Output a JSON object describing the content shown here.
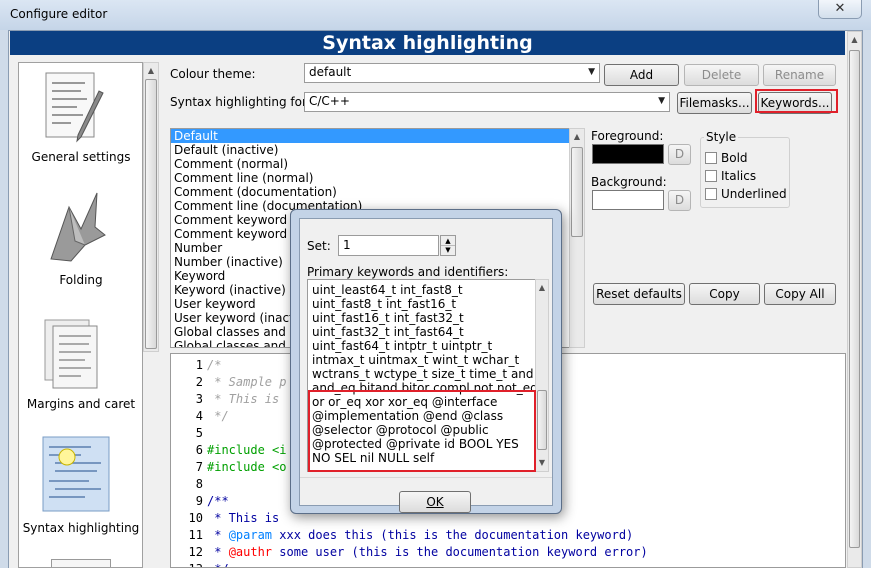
{
  "window": {
    "title": "Configure editor",
    "close_glyph": "✕"
  },
  "banner": {
    "title": "Syntax highlighting"
  },
  "sidebar": {
    "items": [
      {
        "label": "General settings",
        "icon": "general-settings-icon"
      },
      {
        "label": "Folding",
        "icon": "folding-icon"
      },
      {
        "label": "Margins and caret",
        "icon": "margins-caret-icon"
      },
      {
        "label": "Syntax highlighting",
        "icon": "syntax-highlighting-icon",
        "selected": true
      }
    ]
  },
  "theme": {
    "label": "Colour theme:",
    "value": "default",
    "add": "Add",
    "delete": "Delete",
    "rename": "Rename"
  },
  "lang": {
    "label": "Syntax highlighting for:",
    "value": "C/C++",
    "filemasks": "Filemasks...",
    "keywords": "Keywords..."
  },
  "styles": [
    "Default",
    "Default (inactive)",
    "Comment (normal)",
    "Comment line (normal)",
    "Comment (documentation)",
    "Comment line (documentation)",
    "Comment keyword (d",
    "Comment keyword e",
    "Number",
    "Number (inactive)",
    "Keyword",
    "Keyword (inactive)",
    "User keyword",
    "User keyword (inactiv",
    "Global classes and typ",
    "Global classes and ty"
  ],
  "colors_panel": {
    "foreground": "Foreground:",
    "background": "Background:",
    "d": "D",
    "style": "Style",
    "bold": "Bold",
    "italics": "Italics",
    "underlined": "Underlined",
    "fg_color": "#000000",
    "bg_color": "#ffffff"
  },
  "actions": {
    "reset": "Reset defaults",
    "copy": "Copy",
    "copy_all": "Copy All"
  },
  "editor": {
    "lines": [
      {
        "num": "1",
        "text": "/*",
        "kind": "comment"
      },
      {
        "num": "2",
        "text": " * Sample p",
        "kind": "comment"
      },
      {
        "num": "3",
        "text": " * This is",
        "kind": "comment"
      },
      {
        "num": "4",
        "text": " */",
        "kind": "comment"
      },
      {
        "num": "5",
        "text": "",
        "kind": "plain"
      },
      {
        "num": "6",
        "text": "#include <i",
        "kind": "inc"
      },
      {
        "num": "7",
        "text": "#include <o",
        "kind": "inc"
      },
      {
        "num": "8",
        "text": "",
        "kind": "plain"
      },
      {
        "num": "9",
        "text": "/**",
        "kind": "doc"
      },
      {
        "num": "10",
        "text": " * This is",
        "kind": "doc"
      },
      {
        "num": "11",
        "text": " * @param xxx does this (this is the documentation keyword)",
        "kind": "dockw"
      },
      {
        "num": "12",
        "text": " * @authr some user (this is the documentation keyword error)",
        "kind": "docerr"
      },
      {
        "num": "13",
        "text": " */",
        "kind": "doc"
      }
    ]
  },
  "modal": {
    "set_label": "Set:",
    "set_value": "1",
    "list_label": "Primary keywords and identifiers:",
    "keyword_lines": [
      "uint_least64_t int_fast8_t",
      "uint_fast8_t int_fast16_t",
      "uint_fast16_t int_fast32_t",
      "uint_fast32_t int_fast64_t",
      "uint_fast64_t intptr_t uintptr_t",
      "intmax_t uintmax_t wint_t wchar_t",
      "wctrans_t wctype_t size_t time_t and",
      "and_eq bitand bitor compl not not_eq",
      "or or_eq xor xor_eq @interface",
      "@implementation @end  @class",
      "@selector @protocol @public",
      "@protected @private id BOOL YES",
      "NO SEL nil  NULL self"
    ],
    "ok": "OK"
  }
}
